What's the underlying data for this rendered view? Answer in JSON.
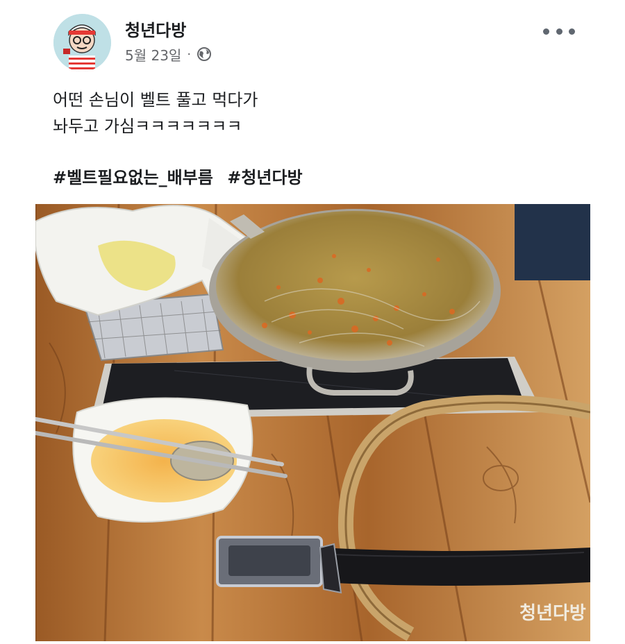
{
  "post": {
    "page_name": "청년다방",
    "date": "5월 23일",
    "separator": "·",
    "audience_icon": "globe-icon",
    "more_icon": "more-options-icon",
    "text_lines": [
      "어떤 손님이 벨트 풀고 먹다가",
      "놔두고 가심ㅋㅋㅋㅋㅋㅋㅋ"
    ],
    "hashtags": [
      "#벨트필요없는_배부름",
      "#청년다방"
    ]
  },
  "photo": {
    "watermark": "청년다방"
  },
  "colors": {
    "text_primary": "#1c1e21",
    "text_secondary": "#65676b"
  }
}
